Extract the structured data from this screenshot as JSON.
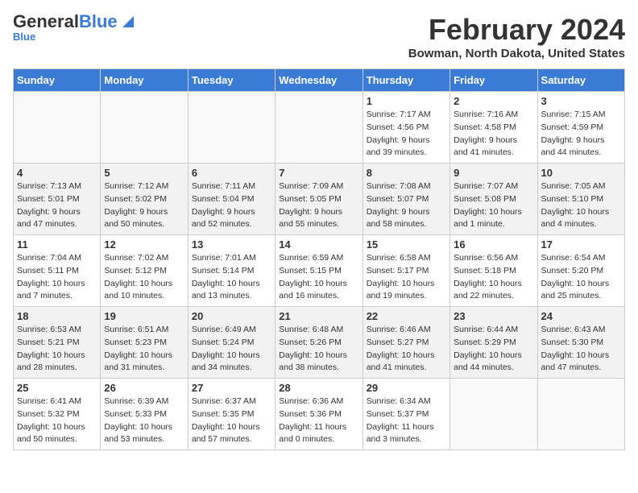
{
  "header": {
    "logo_general": "General",
    "logo_blue": "Blue",
    "month_year": "February 2024",
    "location": "Bowman, North Dakota, United States"
  },
  "days_of_week": [
    "Sunday",
    "Monday",
    "Tuesday",
    "Wednesday",
    "Thursday",
    "Friday",
    "Saturday"
  ],
  "weeks": [
    {
      "shade": false,
      "days": [
        {
          "num": "",
          "detail": ""
        },
        {
          "num": "",
          "detail": ""
        },
        {
          "num": "",
          "detail": ""
        },
        {
          "num": "",
          "detail": ""
        },
        {
          "num": "1",
          "detail": "Sunrise: 7:17 AM\nSunset: 4:56 PM\nDaylight: 9 hours\nand 39 minutes."
        },
        {
          "num": "2",
          "detail": "Sunrise: 7:16 AM\nSunset: 4:58 PM\nDaylight: 9 hours\nand 41 minutes."
        },
        {
          "num": "3",
          "detail": "Sunrise: 7:15 AM\nSunset: 4:59 PM\nDaylight: 9 hours\nand 44 minutes."
        }
      ]
    },
    {
      "shade": true,
      "days": [
        {
          "num": "4",
          "detail": "Sunrise: 7:13 AM\nSunset: 5:01 PM\nDaylight: 9 hours\nand 47 minutes."
        },
        {
          "num": "5",
          "detail": "Sunrise: 7:12 AM\nSunset: 5:02 PM\nDaylight: 9 hours\nand 50 minutes."
        },
        {
          "num": "6",
          "detail": "Sunrise: 7:11 AM\nSunset: 5:04 PM\nDaylight: 9 hours\nand 52 minutes."
        },
        {
          "num": "7",
          "detail": "Sunrise: 7:09 AM\nSunset: 5:05 PM\nDaylight: 9 hours\nand 55 minutes."
        },
        {
          "num": "8",
          "detail": "Sunrise: 7:08 AM\nSunset: 5:07 PM\nDaylight: 9 hours\nand 58 minutes."
        },
        {
          "num": "9",
          "detail": "Sunrise: 7:07 AM\nSunset: 5:08 PM\nDaylight: 10 hours\nand 1 minute."
        },
        {
          "num": "10",
          "detail": "Sunrise: 7:05 AM\nSunset: 5:10 PM\nDaylight: 10 hours\nand 4 minutes."
        }
      ]
    },
    {
      "shade": false,
      "days": [
        {
          "num": "11",
          "detail": "Sunrise: 7:04 AM\nSunset: 5:11 PM\nDaylight: 10 hours\nand 7 minutes."
        },
        {
          "num": "12",
          "detail": "Sunrise: 7:02 AM\nSunset: 5:12 PM\nDaylight: 10 hours\nand 10 minutes."
        },
        {
          "num": "13",
          "detail": "Sunrise: 7:01 AM\nSunset: 5:14 PM\nDaylight: 10 hours\nand 13 minutes."
        },
        {
          "num": "14",
          "detail": "Sunrise: 6:59 AM\nSunset: 5:15 PM\nDaylight: 10 hours\nand 16 minutes."
        },
        {
          "num": "15",
          "detail": "Sunrise: 6:58 AM\nSunset: 5:17 PM\nDaylight: 10 hours\nand 19 minutes."
        },
        {
          "num": "16",
          "detail": "Sunrise: 6:56 AM\nSunset: 5:18 PM\nDaylight: 10 hours\nand 22 minutes."
        },
        {
          "num": "17",
          "detail": "Sunrise: 6:54 AM\nSunset: 5:20 PM\nDaylight: 10 hours\nand 25 minutes."
        }
      ]
    },
    {
      "shade": true,
      "days": [
        {
          "num": "18",
          "detail": "Sunrise: 6:53 AM\nSunset: 5:21 PM\nDaylight: 10 hours\nand 28 minutes."
        },
        {
          "num": "19",
          "detail": "Sunrise: 6:51 AM\nSunset: 5:23 PM\nDaylight: 10 hours\nand 31 minutes."
        },
        {
          "num": "20",
          "detail": "Sunrise: 6:49 AM\nSunset: 5:24 PM\nDaylight: 10 hours\nand 34 minutes."
        },
        {
          "num": "21",
          "detail": "Sunrise: 6:48 AM\nSunset: 5:26 PM\nDaylight: 10 hours\nand 38 minutes."
        },
        {
          "num": "22",
          "detail": "Sunrise: 6:46 AM\nSunset: 5:27 PM\nDaylight: 10 hours\nand 41 minutes."
        },
        {
          "num": "23",
          "detail": "Sunrise: 6:44 AM\nSunset: 5:29 PM\nDaylight: 10 hours\nand 44 minutes."
        },
        {
          "num": "24",
          "detail": "Sunrise: 6:43 AM\nSunset: 5:30 PM\nDaylight: 10 hours\nand 47 minutes."
        }
      ]
    },
    {
      "shade": false,
      "days": [
        {
          "num": "25",
          "detail": "Sunrise: 6:41 AM\nSunset: 5:32 PM\nDaylight: 10 hours\nand 50 minutes."
        },
        {
          "num": "26",
          "detail": "Sunrise: 6:39 AM\nSunset: 5:33 PM\nDaylight: 10 hours\nand 53 minutes."
        },
        {
          "num": "27",
          "detail": "Sunrise: 6:37 AM\nSunset: 5:35 PM\nDaylight: 10 hours\nand 57 minutes."
        },
        {
          "num": "28",
          "detail": "Sunrise: 6:36 AM\nSunset: 5:36 PM\nDaylight: 11 hours\nand 0 minutes."
        },
        {
          "num": "29",
          "detail": "Sunrise: 6:34 AM\nSunset: 5:37 PM\nDaylight: 11 hours\nand 3 minutes."
        },
        {
          "num": "",
          "detail": ""
        },
        {
          "num": "",
          "detail": ""
        }
      ]
    }
  ]
}
